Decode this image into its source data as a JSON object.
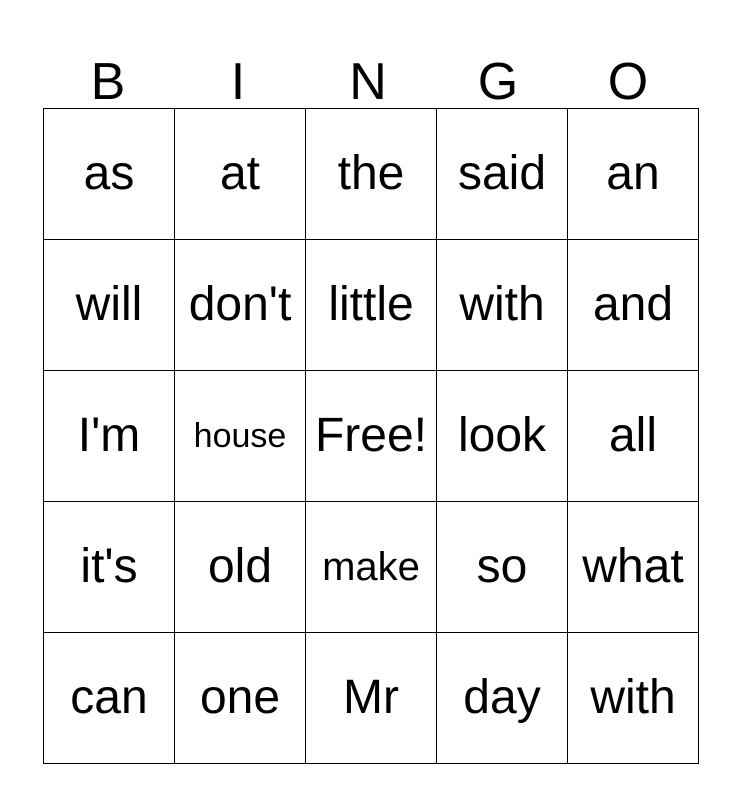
{
  "card": {
    "title": "BINGO",
    "headers": [
      "B",
      "I",
      "N",
      "G",
      "O"
    ],
    "free_space_label": "Free!",
    "colors": {
      "background": "#ffffff",
      "text": "#000000",
      "border": "#000000"
    },
    "rows": [
      [
        {
          "text": "as",
          "size": "lg",
          "free": false
        },
        {
          "text": "at",
          "size": "lg",
          "free": false
        },
        {
          "text": "the",
          "size": "lg",
          "free": false
        },
        {
          "text": "said",
          "size": "lg",
          "free": false
        },
        {
          "text": "an",
          "size": "lg",
          "free": false
        }
      ],
      [
        {
          "text": "will",
          "size": "lg",
          "free": false
        },
        {
          "text": "don't",
          "size": "lg",
          "free": false
        },
        {
          "text": "little",
          "size": "lg",
          "free": false
        },
        {
          "text": "with",
          "size": "lg",
          "free": false
        },
        {
          "text": "and",
          "size": "lg",
          "free": false
        }
      ],
      [
        {
          "text": "I'm",
          "size": "lg",
          "free": false
        },
        {
          "text": "house",
          "size": "sm",
          "free": false
        },
        {
          "text": "Free!",
          "size": "lg",
          "free": true
        },
        {
          "text": "look",
          "size": "lg",
          "free": false
        },
        {
          "text": "all",
          "size": "lg",
          "free": false
        }
      ],
      [
        {
          "text": "it's",
          "size": "lg",
          "free": false
        },
        {
          "text": "old",
          "size": "lg",
          "free": false
        },
        {
          "text": "make",
          "size": "md",
          "free": false
        },
        {
          "text": "so",
          "size": "lg",
          "free": false
        },
        {
          "text": "what",
          "size": "lg",
          "free": false
        }
      ],
      [
        {
          "text": "can",
          "size": "lg",
          "free": false
        },
        {
          "text": "one",
          "size": "lg",
          "free": false
        },
        {
          "text": "Mr",
          "size": "lg",
          "free": false
        },
        {
          "text": "day",
          "size": "lg",
          "free": false
        },
        {
          "text": "with",
          "size": "lg",
          "free": false
        }
      ]
    ]
  }
}
